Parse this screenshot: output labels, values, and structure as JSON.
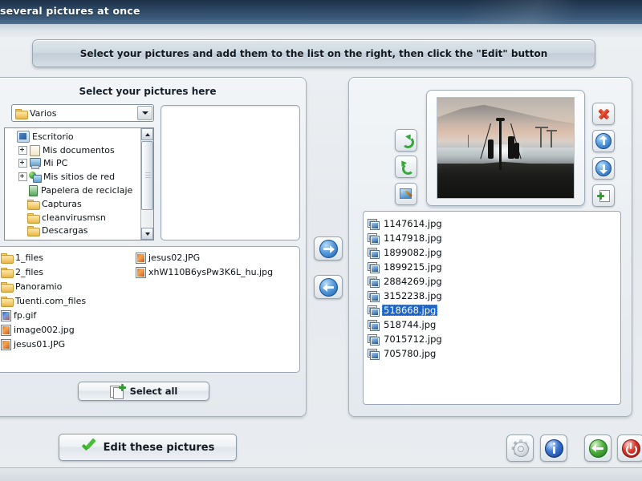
{
  "window": {
    "title": "several pictures at once"
  },
  "banner": {
    "text": "Select your pictures and add them to the list on the right, then click the \"Edit\" button"
  },
  "left_panel": {
    "title": "Select your pictures here",
    "folder_combo": {
      "value": "Varios",
      "icon": "folder-icon"
    },
    "tree": [
      {
        "label": "Escritorio",
        "icon": "desktop-icon",
        "indent": 0,
        "expander": "none"
      },
      {
        "label": "Mis documentos",
        "icon": "documents-icon",
        "indent": 1,
        "expander": "plus"
      },
      {
        "label": "Mi PC",
        "icon": "computer-icon",
        "indent": 1,
        "expander": "plus"
      },
      {
        "label": "Mis sitios de red",
        "icon": "network-icon",
        "indent": 1,
        "expander": "plus"
      },
      {
        "label": "Papelera de reciclaje",
        "icon": "recycle-bin-icon",
        "indent": 1,
        "expander": "none"
      },
      {
        "label": "Capturas",
        "icon": "folder-icon",
        "indent": 1,
        "expander": "none"
      },
      {
        "label": "cleanvirusmsn",
        "icon": "folder-icon",
        "indent": 1,
        "expander": "none"
      },
      {
        "label": "Descargas",
        "icon": "folder-icon",
        "indent": 1,
        "expander": "none"
      }
    ],
    "files_column_1": [
      {
        "name": "1_files",
        "icon": "folder-icon"
      },
      {
        "name": "2_files",
        "icon": "folder-icon"
      },
      {
        "name": "Panoramio",
        "icon": "folder-icon"
      },
      {
        "name": "Tuenti.com_files",
        "icon": "folder-icon"
      },
      {
        "name": "fp.gif",
        "icon": "gif-file-icon"
      },
      {
        "name": "image002.jpg",
        "icon": "jpg-file-icon"
      },
      {
        "name": "jesus01.JPG",
        "icon": "jpg-file-icon"
      }
    ],
    "files_column_2": [
      {
        "name": "jesus02.JPG",
        "icon": "jpg-file-icon"
      },
      {
        "name": "xhW110B6ysPw3K6L_hu.jpg",
        "icon": "jpg-file-icon"
      }
    ],
    "select_all_button": "Select all"
  },
  "transfer": {
    "add_label": "add-to-list",
    "remove_label": "remove-from-list"
  },
  "right_panel": {
    "preview": {
      "description": "silhouette of people at dusk beach with mast structure"
    },
    "tools_left": [
      {
        "name": "rotate-right-button"
      },
      {
        "name": "rotate-left-button"
      },
      {
        "name": "effects-button"
      }
    ],
    "tools_right": [
      {
        "name": "remove-button"
      },
      {
        "name": "move-up-button"
      },
      {
        "name": "move-down-button"
      },
      {
        "name": "add-file-button"
      }
    ],
    "files": [
      {
        "name": "1147614.jpg",
        "selected": false
      },
      {
        "name": "1147918.jpg",
        "selected": false
      },
      {
        "name": "1899082.jpg",
        "selected": false
      },
      {
        "name": "1899215.jpg",
        "selected": false
      },
      {
        "name": "2884269.jpg",
        "selected": false
      },
      {
        "name": "3152238.jpg",
        "selected": false
      },
      {
        "name": "518668.jpg",
        "selected": true
      },
      {
        "name": "518744.jpg",
        "selected": false
      },
      {
        "name": "7015712.jpg",
        "selected": false
      },
      {
        "name": "705780.jpg",
        "selected": false
      }
    ]
  },
  "footer": {
    "edit_button": "Edit these pictures",
    "settings_button": "gear-icon",
    "info_button": "info-icon",
    "back_button": "back-icon",
    "exit_button": "power-icon"
  },
  "colors": {
    "titlebar": "#2c4763",
    "selection": "#1d64c8",
    "accent_green": "#35a83a",
    "accent_blue": "#1d5fae",
    "accent_red": "#cf2d1c"
  }
}
